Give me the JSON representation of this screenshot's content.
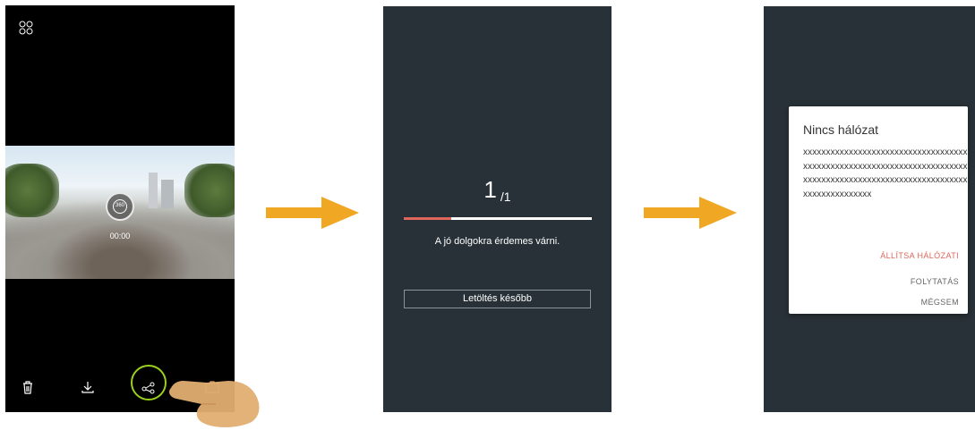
{
  "screen1": {
    "play_badge": "360",
    "time": "00:00",
    "toolbar_icons": [
      "trash-icon",
      "download-icon",
      "share-icon",
      "camera-switch-icon"
    ],
    "highlight_color": "#9bd11c"
  },
  "screen2": {
    "count_current": "1",
    "count_total": "/1",
    "progress": 0.25,
    "message": "A jó dolgokra érdemes várni.",
    "later_button": "Letöltés később",
    "accent_color": "#e0665a"
  },
  "screen3": {
    "dialog": {
      "title": "Nincs hálózat",
      "body": "xxxxxxxxxxxxxxxxxxxxxxxxxxxxxxxxxxxxxxxxxxxxxxxxxxxxxxxxxxxxxxxxxxxxxxxxxxxxxxxxxxxxxxxxxxxxxxxxxxxxxxxxxxxxxxxxxxxxxxxxxxx",
      "network_settings": "ÁLLÍTSA HÁLÓZATI",
      "continue": "FOLYTATÁS",
      "cancel": "MÉGSEM"
    }
  },
  "colors": {
    "arrow": "#f0a824",
    "dark_background": "#283137"
  }
}
